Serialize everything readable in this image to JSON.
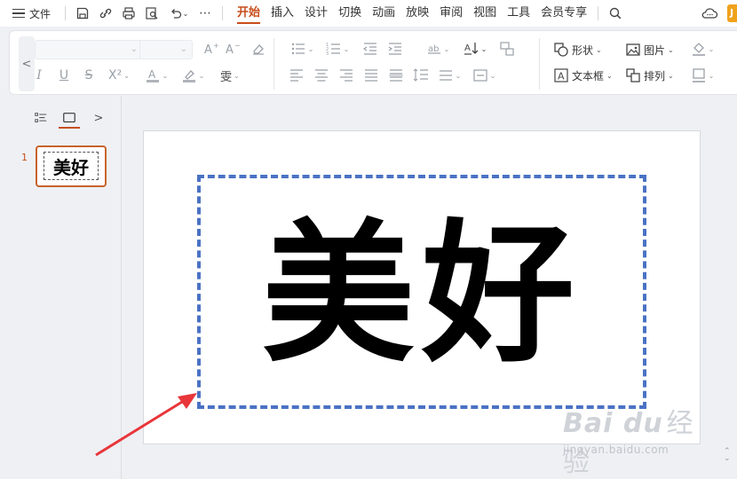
{
  "app": {
    "menu_label": "文件",
    "tabs": [
      "开始",
      "插入",
      "设计",
      "切换",
      "动画",
      "放映",
      "审阅",
      "视图",
      "工具",
      "会员专享"
    ],
    "active_tab": "开始",
    "user_initial": "J"
  },
  "ribbon": {
    "shape_label": "形状",
    "picture_label": "图片",
    "textbox_label": "文本框",
    "arrange_label": "排列",
    "font_box_dropdown": "⌄",
    "size_box_dropdown": "⌄"
  },
  "slide_panel": {
    "slide_number": "1",
    "thumb_text": "美好"
  },
  "slide": {
    "text": "美好"
  },
  "watermark": {
    "logo": "Bai du",
    "jy": "经验",
    "url": "jingyan.baidu.com"
  },
  "colors": {
    "accent": "#c84e1b",
    "selection_border": "#4a72c4",
    "arrow": "#e8363a"
  }
}
